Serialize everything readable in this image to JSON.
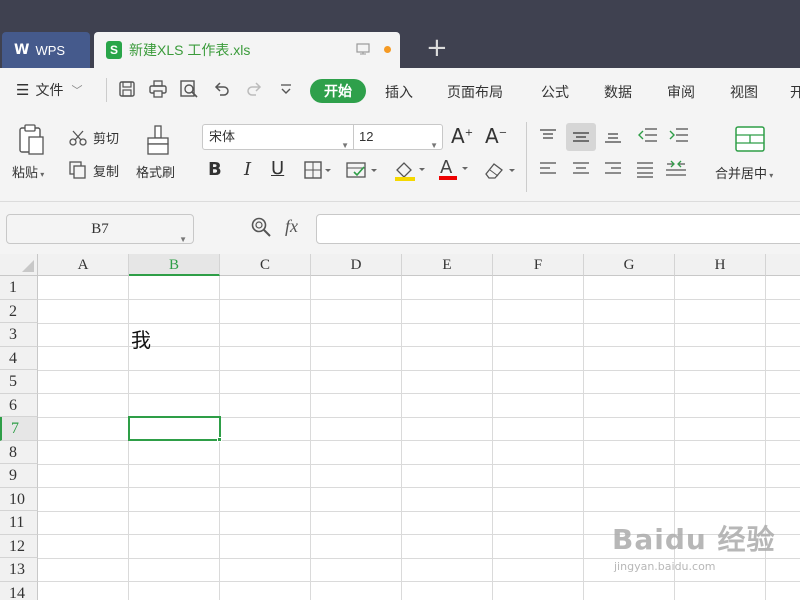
{
  "titlebar": {
    "app_tab": "WPS",
    "doc_tab": "新建XLS 工作表.xls",
    "new_tab": "+"
  },
  "menu": {
    "file": "文件",
    "tabs": [
      "开始",
      "插入",
      "页面布局",
      "公式",
      "数据",
      "审阅",
      "视图",
      "开"
    ]
  },
  "ribbon": {
    "paste": "粘贴",
    "cut": "剪切",
    "copy": "复制",
    "format_painter": "格式刷",
    "font_name": "宋体",
    "font_size": "12",
    "merge_center": "合并居中"
  },
  "formula_bar": {
    "name_box": "B7",
    "fx": "fx",
    "formula": ""
  },
  "sheet": {
    "columns": [
      "A",
      "B",
      "C",
      "D",
      "E",
      "F",
      "G",
      "H"
    ],
    "rows": [
      "1",
      "2",
      "3",
      "4",
      "5",
      "6",
      "7",
      "8",
      "9",
      "10",
      "11",
      "12",
      "13",
      "14"
    ],
    "selected_column": "B",
    "selected_row": "7",
    "cell_B3": "我"
  },
  "watermark": {
    "line1": "Baidu 经验",
    "line2": "jingyan.baidu.com"
  },
  "colors": {
    "titlebar": "#3f4150",
    "accent_green": "#2e9e47",
    "wps_tab": "#455a8c"
  }
}
